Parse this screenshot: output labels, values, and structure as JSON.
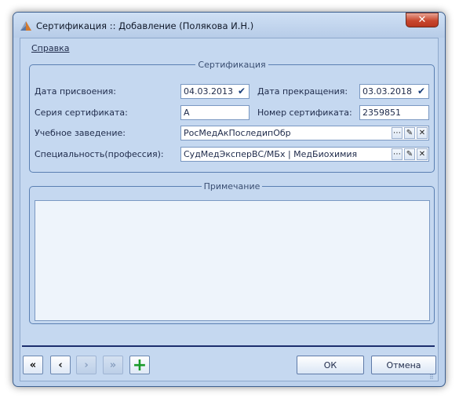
{
  "window": {
    "title": "Сертификация :: Добавление  (Полякова И.Н.)",
    "close_symbol": "✕",
    "icon": "app-icon"
  },
  "menu": {
    "help": "Справка"
  },
  "cert_group": {
    "legend": "Сертификация",
    "issue_date_label": "Дата присвоения:",
    "issue_date": "04.03.2013",
    "end_date_label": "Дата прекращения:",
    "end_date": "03.03.2018",
    "series_label": "Серия сертификата:",
    "series": "А",
    "number_label": "Номер сертификата:",
    "number": "2359851",
    "institution_label": "Учебное заведение:",
    "institution": "РосМедАкПоследипОбр",
    "specialty_label": "Специальность(профессия):",
    "specialty": "СудМедЭксперВС/МБх | МедБиохимия"
  },
  "note_group": {
    "legend": "Примечание",
    "text": ""
  },
  "nav": {
    "first": "«",
    "prev": "‹",
    "next": "›",
    "last": "»",
    "add": "+"
  },
  "buttons": {
    "ok": "ОК",
    "cancel": "Отмена"
  },
  "colors": {
    "accent": "#1c2e6e",
    "close": "#c8472e",
    "add": "#1a9b2a"
  }
}
